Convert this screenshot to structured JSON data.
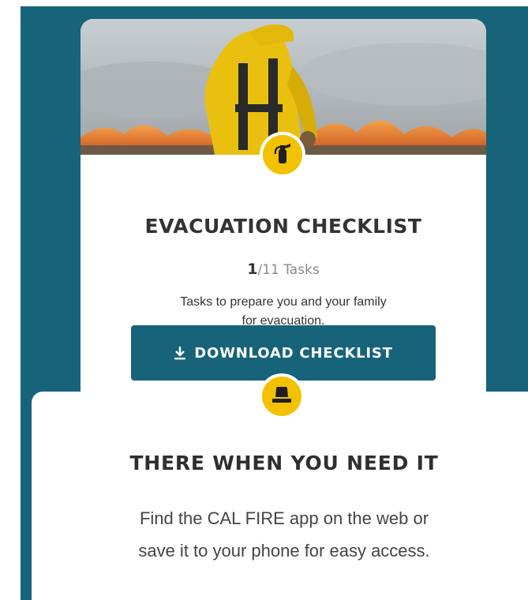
{
  "checklist_card": {
    "title": "EVACUATION CHECKLIST",
    "tasks_completed": "1",
    "tasks_total_label": "/11 Tasks",
    "progress_fraction": 0.0909,
    "description_line1": "Tasks to prepare you and your family",
    "description_line2": "for evacuation.",
    "download_label": "DOWNLOAD CHECKLIST",
    "badge_icon": "fire-extinguisher-icon"
  },
  "app_section": {
    "badge_icon": "emergency-beacon-icon",
    "title": "THERE WHEN YOU NEED IT",
    "description_line1": "Find the CAL FIRE app on the web or",
    "description_line2": "save it to your phone for easy access."
  },
  "colors": {
    "teal": "#16637a",
    "yellow": "#f2c200",
    "text_dark": "#333333",
    "text_muted": "#8a8a8a"
  }
}
